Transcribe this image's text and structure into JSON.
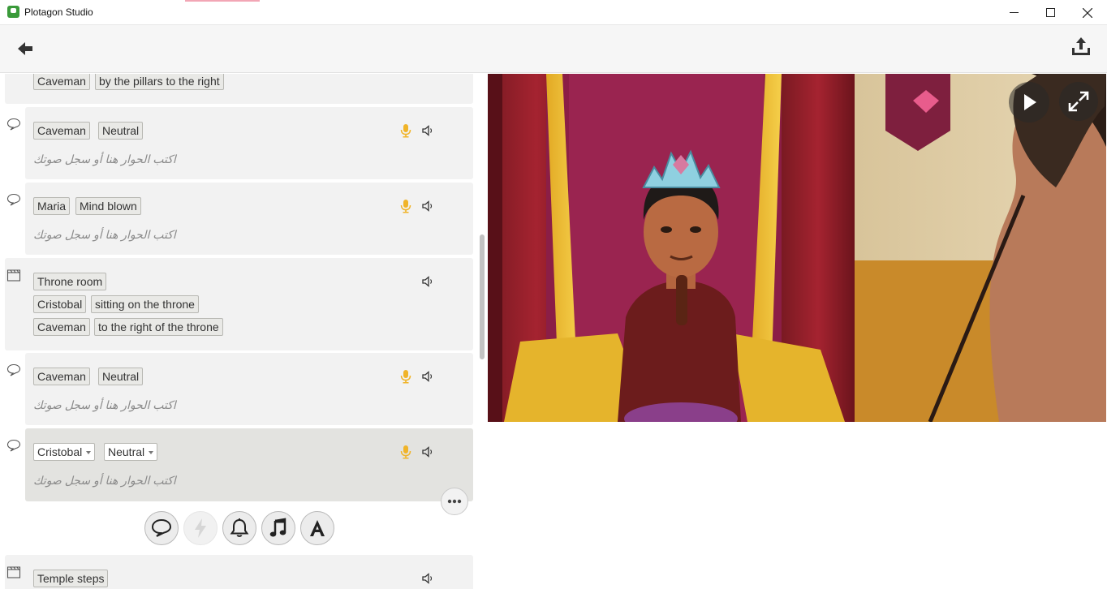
{
  "window": {
    "title": "Plotagon Studio"
  },
  "script": {
    "placeholder": "اكتب الحوار هنا أو سجل صوتك",
    "top_card": {
      "character": "Caveman",
      "position": "by the pillars to the right"
    },
    "dialogue_1": {
      "character": "Caveman",
      "emotion": "Neutral"
    },
    "dialogue_2": {
      "character": "Maria",
      "emotion": "Mind blown"
    },
    "scene": {
      "location": "Throne room",
      "actors": [
        {
          "character": "Cristobal",
          "position": "sitting on the throne"
        },
        {
          "character": "Caveman",
          "position": "to the right of the throne"
        }
      ]
    },
    "dialogue_3": {
      "character": "Caveman",
      "emotion": "Neutral"
    },
    "dialogue_selected": {
      "character": "Cristobal",
      "emotion": "Neutral"
    },
    "bottom_scene": {
      "location": "Temple steps"
    }
  },
  "icons": {
    "dialogue": "speech-bubble-icon",
    "scene": "clapperboard-icon",
    "mic": "microphone-icon",
    "sound": "speaker-icon",
    "action": "lightning-icon",
    "effect": "bell-icon",
    "music": "music-note-icon",
    "text": "text-a-icon",
    "more": "more-icon",
    "back": "back-arrow-icon",
    "share": "share-icon",
    "play": "play-icon",
    "fullscreen": "fullscreen-icon"
  },
  "colors": {
    "mic": "#f0b429",
    "accent_green": "#3a9a3a"
  }
}
